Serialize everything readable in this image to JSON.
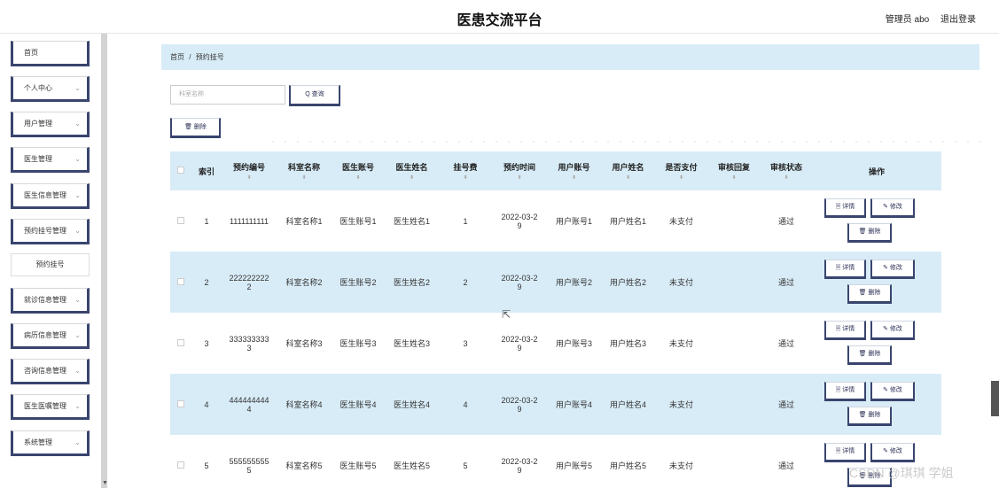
{
  "header": {
    "title": "医患交流平台",
    "user": "管理员 abo",
    "logout": "退出登录"
  },
  "sidebar": {
    "items": [
      {
        "label": "首页",
        "chevron": false
      },
      {
        "label": "个人中心",
        "chevron": true
      },
      {
        "label": "用户管理",
        "chevron": true
      },
      {
        "label": "医生管理",
        "chevron": true
      },
      {
        "label": "医生信息管理",
        "chevron": true
      },
      {
        "label": "预约挂号管理",
        "chevron": true
      },
      {
        "label": "预约挂号",
        "sub": true
      },
      {
        "label": "就诊信息管理",
        "chevron": true
      },
      {
        "label": "病历信息管理",
        "chevron": true
      },
      {
        "label": "咨询信息管理",
        "chevron": true
      },
      {
        "label": "医生医嘱管理",
        "chevron": true
      },
      {
        "label": "系统管理",
        "chevron": true
      }
    ]
  },
  "breadcrumb": {
    "home": "首页",
    "sep": "/",
    "current": "预约挂号"
  },
  "search": {
    "placeholder": "科室名称",
    "query_label": "Q 查询",
    "delete_label": "🗑 删除"
  },
  "table": {
    "headers": [
      "索引",
      "预约编号",
      "科室名称",
      "医生账号",
      "医生姓名",
      "挂号费",
      "预约时间",
      "用户账号",
      "用户姓名",
      "是否支付",
      "审核回复",
      "审核状态",
      "操作"
    ],
    "rows": [
      {
        "idx": "1",
        "no": "1111111111",
        "dept": "科室名称1",
        "doc_acc": "医生账号1",
        "doc_name": "医生姓名1",
        "fee": "1",
        "time": "2022-03-29",
        "user_acc": "用户账号1",
        "user_name": "用户姓名1",
        "paid": "未支付",
        "reply": "",
        "status": "通过"
      },
      {
        "idx": "2",
        "no": "2222222222",
        "dept": "科室名称2",
        "doc_acc": "医生账号2",
        "doc_name": "医生姓名2",
        "fee": "2",
        "time": "2022-03-29",
        "user_acc": "用户账号2",
        "user_name": "用户姓名2",
        "paid": "未支付",
        "reply": "",
        "status": "通过"
      },
      {
        "idx": "3",
        "no": "3333333333",
        "dept": "科室名称3",
        "doc_acc": "医生账号3",
        "doc_name": "医生姓名3",
        "fee": "3",
        "time": "2022-03-29",
        "user_acc": "用户账号3",
        "user_name": "用户姓名3",
        "paid": "未支付",
        "reply": "",
        "status": "通过"
      },
      {
        "idx": "4",
        "no": "4444444444",
        "dept": "科室名称4",
        "doc_acc": "医生账号4",
        "doc_name": "医生姓名4",
        "fee": "4",
        "time": "2022-03-29",
        "user_acc": "用户账号4",
        "user_name": "用户姓名4",
        "paid": "未支付",
        "reply": "",
        "status": "通过"
      },
      {
        "idx": "5",
        "no": "5555555555",
        "dept": "科室名称5",
        "doc_acc": "医生账号5",
        "doc_name": "医生姓名5",
        "fee": "5",
        "time": "2022-03-29",
        "user_acc": "用户账号5",
        "user_name": "用户姓名5",
        "paid": "未支付",
        "reply": "",
        "status": "通过"
      }
    ],
    "actions": {
      "detail": "🗏 详情",
      "edit": "✎ 修改",
      "delete": "🗑 删除"
    },
    "sort_icon": "sort-icon"
  },
  "watermark": "CSDN @琪琪 学姐",
  "colors": {
    "accent": "#39456e",
    "row_highlight": "#d8ecf7"
  }
}
